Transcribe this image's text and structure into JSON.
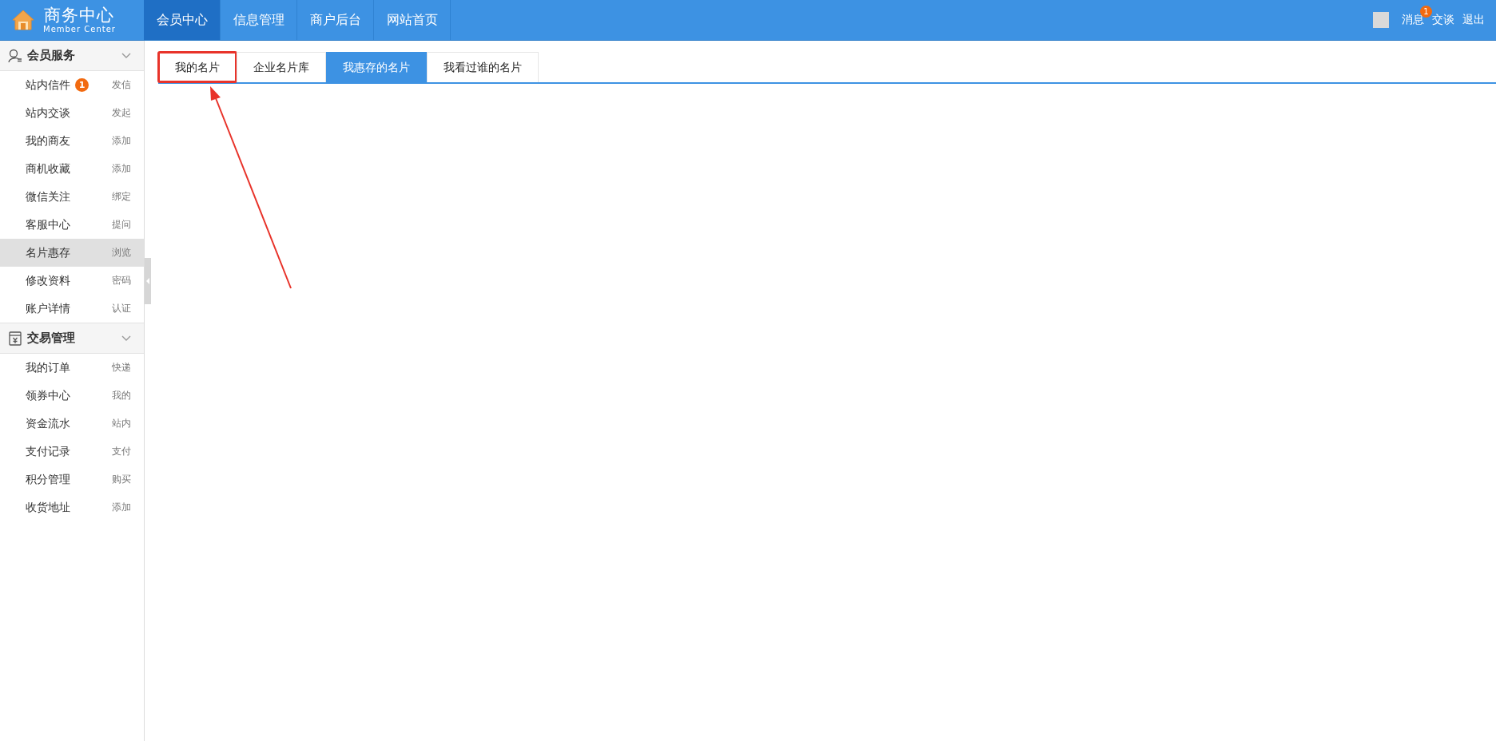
{
  "header": {
    "logo_title": "商务中心",
    "logo_subtitle": "Member Center",
    "nav": [
      {
        "label": "会员中心",
        "selected": true
      },
      {
        "label": "信息管理",
        "selected": false
      },
      {
        "label": "商户后台",
        "selected": false
      },
      {
        "label": "网站首页",
        "selected": false
      }
    ],
    "user_links": [
      {
        "label": "消息",
        "badge": "1"
      },
      {
        "label": "交谈"
      },
      {
        "label": "退出"
      }
    ]
  },
  "sidebar": {
    "groups": [
      {
        "title": "会员服务",
        "expanded": true,
        "items": [
          {
            "label": "站内信件",
            "badge": "1",
            "action": "发信",
            "selected": false
          },
          {
            "label": "站内交谈",
            "action": "发起",
            "selected": false
          },
          {
            "label": "我的商友",
            "action": "添加",
            "selected": false
          },
          {
            "label": "商机收藏",
            "action": "添加",
            "selected": false
          },
          {
            "label": "微信关注",
            "action": "绑定",
            "selected": false
          },
          {
            "label": "客服中心",
            "action": "提问",
            "selected": false
          },
          {
            "label": "名片惠存",
            "action": "浏览",
            "selected": true
          },
          {
            "label": "修改资料",
            "action": "密码",
            "selected": false
          },
          {
            "label": "账户详情",
            "action": "认证",
            "selected": false
          }
        ]
      },
      {
        "title": "交易管理",
        "expanded": true,
        "items": [
          {
            "label": "我的订单",
            "action": "快递",
            "selected": false
          },
          {
            "label": "领券中心",
            "action": "我的",
            "selected": false
          },
          {
            "label": "资金流水",
            "action": "站内",
            "selected": false
          },
          {
            "label": "支付记录",
            "action": "支付",
            "selected": false
          },
          {
            "label": "积分管理",
            "action": "购买",
            "selected": false
          },
          {
            "label": "收货地址",
            "action": "添加",
            "selected": false
          }
        ]
      }
    ]
  },
  "tabs": [
    {
      "label": "我的名片",
      "selected": false,
      "highlighted": true
    },
    {
      "label": "企业名片库",
      "selected": false,
      "highlighted": false
    },
    {
      "label": "我惠存的名片",
      "selected": true,
      "highlighted": false
    },
    {
      "label": "我看过谁的名片",
      "selected": false,
      "highlighted": false
    }
  ]
}
